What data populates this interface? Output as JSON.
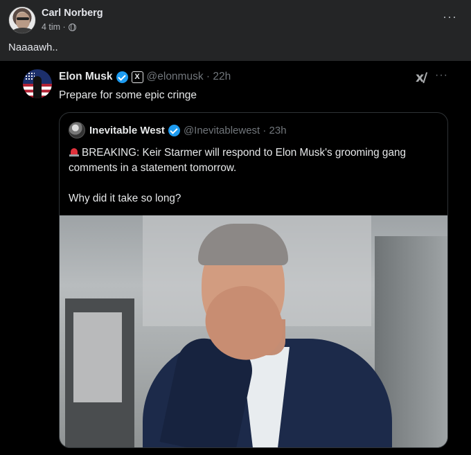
{
  "fb_post": {
    "author": "Carl Norberg",
    "time": "4 tim ·",
    "text": "Naaaawh..",
    "more_label": "···"
  },
  "tweet": {
    "author_name": "Elon Musk",
    "author_handle_time": "@elonmusk · 22h",
    "text": "Prepare for some epic cringe",
    "grok_label": "x/",
    "more_label": "···",
    "x_badge": "X"
  },
  "quoted_tweet": {
    "author_name": "Inevitable West",
    "author_handle_time": "@Inevitablewest · 23h",
    "line1": "BREAKING: Keir Starmer will respond to Elon Musk's grooming gang",
    "line2": "comments in a statement tomorrow.",
    "line3": "Why did it take so long?"
  },
  "colors": {
    "fb_bg": "#242526",
    "tweet_bg": "#000000",
    "verified": "#1d9bf0",
    "handle": "#71767b"
  }
}
